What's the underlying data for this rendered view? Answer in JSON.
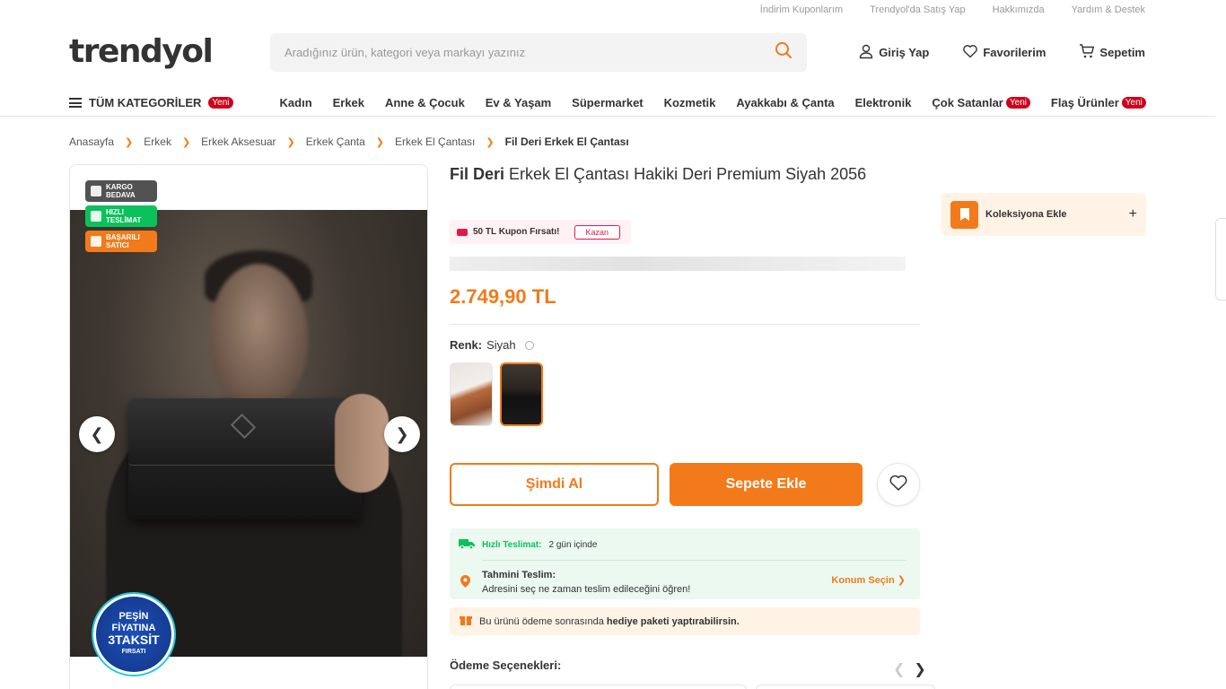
{
  "top_links": [
    "İndirim Kuponlarım",
    "Trendyol'da Satış Yap",
    "Hakkımızda",
    "Yardım & Destek"
  ],
  "header": {
    "logo": "trendyol",
    "search_placeholder": "Aradığınız ürün, kategori veya markayı yazınız",
    "login": "Giriş Yap",
    "favorites": "Favorilerim",
    "cart": "Sepetim"
  },
  "nav": {
    "all_categories": "TÜM KATEGORİLER",
    "new_badge": "Yeni",
    "items": [
      "Kadın",
      "Erkek",
      "Anne & Çocuk",
      "Ev & Yaşam",
      "Süpermarket",
      "Kozmetik",
      "Ayakkabı & Çanta",
      "Elektronik",
      "Çok Satanlar",
      "Flaş Ürünler"
    ]
  },
  "breadcrumb": [
    "Anasayfa",
    "Erkek",
    "Erkek Aksesuar",
    "Erkek Çanta",
    "Erkek El Çantası",
    "Fil Deri Erkek El Çantası"
  ],
  "gallery": {
    "badges": [
      "KARGO BEDAVA",
      "HIZLI TESLİMAT",
      "BAŞARILI SATICI"
    ],
    "taksit": {
      "line1": "PEŞİN",
      "line2": "FİYATINA",
      "line3": "3TAKSİT",
      "line4": "FIRSATI"
    }
  },
  "product": {
    "brand": "Fil Deri",
    "name": "Erkek El Çantası Hakiki Deri Premium Siyah 2056",
    "coupon": "50 TL Kupon Fırsatı!",
    "coupon_action": "Kazan",
    "price": "2.749,90 TL",
    "color_label": "Renk:",
    "color_value": "Siyah",
    "buy_now": "Şimdi Al",
    "add_to_cart": "Sepete Ekle"
  },
  "delivery": {
    "fast_label": "Hızlı Teslimat:",
    "fast_value": "2 gün içinde",
    "estimated_title": "Tahmini Teslim:",
    "estimated_text": "Adresini seç ne zaman teslim edileceğini öğren!",
    "location_action": "Konum Seçin"
  },
  "gift": {
    "text": "Bu ürünü ödeme sonrasında",
    "bold": "hediye paketi yaptırabilirsin."
  },
  "payment_title": "Ödeme Seçenekleri:",
  "collection": "Koleksiyona Ekle",
  "colors": {
    "brand_orange": "#f27a1a",
    "green": "#0bc15c",
    "new_badge": "#d0021b"
  }
}
